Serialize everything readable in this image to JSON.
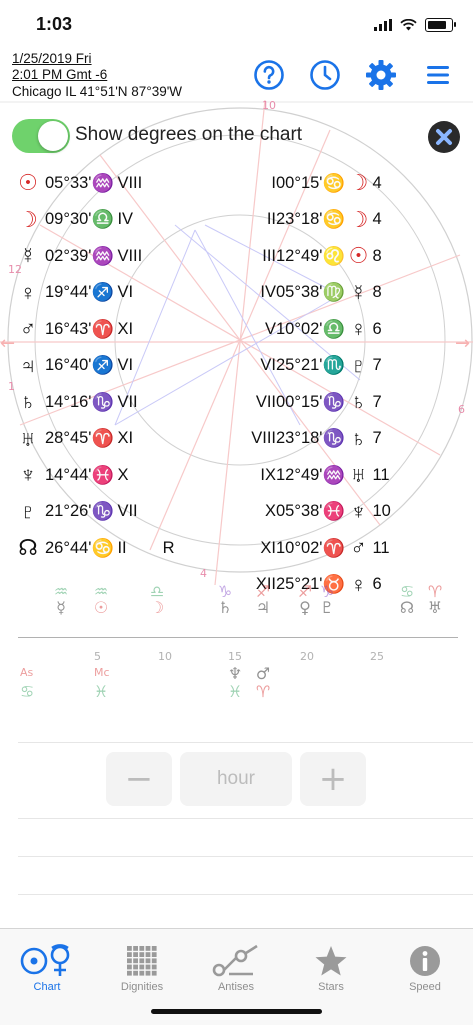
{
  "status": {
    "time": "1:03"
  },
  "header": {
    "date": "1/25/2019 Fri",
    "time": "2:01 PM Gmt -6",
    "place": "Chicago IL 41°51'N 87°39'W"
  },
  "toolbar": {
    "help_icon": "question-circle-icon",
    "history_icon": "clock-icon",
    "settings_icon": "gear-icon",
    "menu_icon": "hamburger-icon",
    "accent_color": "#1a73e8"
  },
  "toggle": {
    "label": "Show degrees on the chart",
    "on": true,
    "color": "#6fd26c"
  },
  "planets": [
    {
      "glyph": "☉",
      "glyph_color": "#d62828",
      "degree": "05°33'",
      "sign": "♒",
      "sign_color": "#2e9e5b",
      "house": "VIII"
    },
    {
      "glyph": "☽",
      "glyph_color": "#d62828",
      "degree": "09°30'",
      "sign": "♎",
      "sign_color": "#2e9e5b",
      "house": "IV"
    },
    {
      "glyph": "☿",
      "glyph_color": "#111111",
      "degree": "02°39'",
      "sign": "♒",
      "sign_color": "#2e9e5b",
      "house": "VIII"
    },
    {
      "glyph": "♀",
      "glyph_color": "#111111",
      "degree": "19°44'",
      "sign": "♐",
      "sign_color": "#d62828",
      "house": "VI"
    },
    {
      "glyph": "♂",
      "glyph_color": "#111111",
      "degree": "16°43'",
      "sign": "♈",
      "sign_color": "#d62828",
      "house": "XI"
    },
    {
      "glyph": "♃",
      "glyph_color": "#111111",
      "degree": "16°40'",
      "sign": "♐",
      "sign_color": "#d62828",
      "house": "VI"
    },
    {
      "glyph": "♄",
      "glyph_color": "#111111",
      "degree": "14°16'",
      "sign": "♑",
      "sign_color": "#7b3fc4",
      "house": "VII"
    },
    {
      "glyph": "♅",
      "glyph_color": "#111111",
      "degree": "28°45'",
      "sign": "♈",
      "sign_color": "#d62828",
      "house": "XI"
    },
    {
      "glyph": "♆",
      "glyph_color": "#111111",
      "degree": "14°44'",
      "sign": "♓",
      "sign_color": "#2e9e5b",
      "house": "X"
    },
    {
      "glyph": "♇",
      "glyph_color": "#111111",
      "degree": "21°26'",
      "sign": "♑",
      "sign_color": "#7b3fc4",
      "house": "VII"
    },
    {
      "glyph": "☊",
      "glyph_color": "#111111",
      "degree": "26°44'",
      "sign": "♋",
      "sign_color": "#2e9e5b",
      "house": "II",
      "extra": "R"
    }
  ],
  "houses": [
    {
      "house": "I",
      "degree": "00°15'",
      "sign": "♋",
      "sign_color": "#2e9e5b",
      "ruler": "☽",
      "ruler_color": "#d62828",
      "ruler_house": "4"
    },
    {
      "house": "II",
      "degree": "23°18'",
      "sign": "♋",
      "sign_color": "#2e9e5b",
      "ruler": "☽",
      "ruler_color": "#d62828",
      "ruler_house": "4"
    },
    {
      "house": "III",
      "degree": "12°49'",
      "sign": "♌",
      "sign_color": "#d62828",
      "ruler": "☉",
      "ruler_color": "#d62828",
      "ruler_house": "8"
    },
    {
      "house": "IV",
      "degree": "05°38'",
      "sign": "♍",
      "sign_color": "#7b3fc4",
      "ruler": "☿",
      "ruler_color": "#111111",
      "ruler_house": "8"
    },
    {
      "house": "V",
      "degree": "10°02'",
      "sign": "♎",
      "sign_color": "#2e9e5b",
      "ruler": "♀",
      "ruler_color": "#111111",
      "ruler_house": "6"
    },
    {
      "house": "VI",
      "degree": "25°21'",
      "sign": "♏",
      "sign_color": "#2e9e5b",
      "ruler": "♇",
      "ruler_color": "#111111",
      "ruler_house": "7"
    },
    {
      "house": "VII",
      "degree": "00°15'",
      "sign": "♑",
      "sign_color": "#7b3fc4",
      "ruler": "♄",
      "ruler_color": "#111111",
      "ruler_house": "7"
    },
    {
      "house": "VIII",
      "degree": "23°18'",
      "sign": "♑",
      "sign_color": "#7b3fc4",
      "ruler": "♄",
      "ruler_color": "#111111",
      "ruler_house": "7"
    },
    {
      "house": "IX",
      "degree": "12°49'",
      "sign": "♒",
      "sign_color": "#2e9e5b",
      "ruler": "♅",
      "ruler_color": "#111111",
      "ruler_house": "11"
    },
    {
      "house": "X",
      "degree": "05°38'",
      "sign": "♓",
      "sign_color": "#2e9e5b",
      "ruler": "♆",
      "ruler_color": "#111111",
      "ruler_house": "10"
    },
    {
      "house": "XI",
      "degree": "10°02'",
      "sign": "♈",
      "sign_color": "#d62828",
      "ruler": "♂",
      "ruler_color": "#111111",
      "ruler_house": "11"
    },
    {
      "house": "XII",
      "degree": "25°21'",
      "sign": "♉",
      "sign_color": "#7b3fc4",
      "ruler": "♀",
      "ruler_color": "#111111",
      "ruler_house": "6"
    }
  ],
  "timeline": {
    "ticks": [
      "5",
      "10",
      "15",
      "20",
      "25"
    ],
    "labels": {
      "as": "As",
      "mc": "Mc"
    }
  },
  "stepper": {
    "minus": "−",
    "unit": "hour",
    "plus": "+"
  },
  "tabs": [
    {
      "label": "Chart",
      "icon": "chart-icon",
      "active": true
    },
    {
      "label": "Dignities",
      "icon": "dignities-grid-icon",
      "active": false
    },
    {
      "label": "Antises",
      "icon": "antises-icon",
      "active": false
    },
    {
      "label": "Stars",
      "icon": "star-icon",
      "active": false
    },
    {
      "label": "Speed",
      "icon": "info-icon",
      "active": false
    }
  ]
}
